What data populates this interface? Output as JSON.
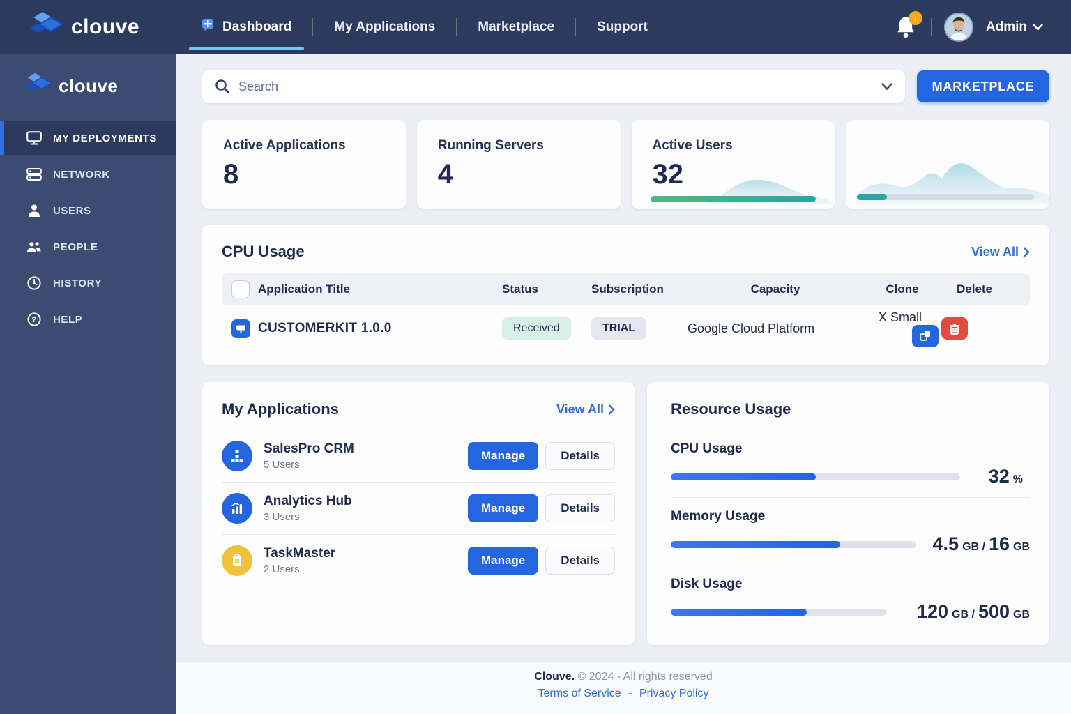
{
  "brand": {
    "name": "clouve"
  },
  "navbar": {
    "tabs": [
      {
        "label": "Dashboard"
      },
      {
        "label": "My Applications"
      },
      {
        "label": "Marketplace"
      },
      {
        "label": "Support"
      }
    ],
    "user": {
      "name": "Admin"
    }
  },
  "sidebar": {
    "items": [
      {
        "label": "MY DEPLOYMENTS"
      },
      {
        "label": "NETWORK"
      },
      {
        "label": "USERS"
      },
      {
        "label": "PEOPLE"
      },
      {
        "label": "HISTORY"
      },
      {
        "label": "HELP"
      }
    ]
  },
  "search": {
    "placeholder": "Search"
  },
  "marketplace_button": "MARKETPLACE",
  "stats": [
    {
      "label": "Active Applications",
      "value": "8"
    },
    {
      "label": "Running Servers",
      "value": "4"
    },
    {
      "label": "Active Users",
      "value": "32",
      "progress": "100%"
    },
    {
      "progress": "17%"
    }
  ],
  "cpu_table": {
    "title": "CPU Usage",
    "view_all": "View All",
    "columns": [
      "Application Title",
      "Status",
      "Subscription",
      "Capacity",
      "Clone",
      "Delete"
    ],
    "row": {
      "title": "CUSTOMERKIT 1.0.0",
      "status": "Received",
      "subscription": "TRIAL",
      "capacity": "Google Cloud Platform",
      "size": "X Small"
    }
  },
  "my_applications": {
    "title": "My Applications",
    "view_all": "View All",
    "manage_label": "Manage",
    "details_label": "Details",
    "apps": [
      {
        "name": "SalesPro CRM",
        "users": "5 Users",
        "icon": "crm-modules-icon",
        "color": "#2465e0"
      },
      {
        "name": "Analytics Hub",
        "users": "3 Users",
        "icon": "bar-chart-icon",
        "color": "#2465e0"
      },
      {
        "name": "TaskMaster",
        "users": "2 Users",
        "icon": "clipboard-icon",
        "color": "#f0c23c"
      }
    ]
  },
  "resource_usage": {
    "title": "Resource Usage",
    "meters": [
      {
        "label": "CPU Usage",
        "fill": "50%",
        "track": "415px",
        "v1": "32",
        "u1": "%",
        "v2": "",
        "u2": ""
      },
      {
        "label": "Memory Usage",
        "fill": "69%",
        "track": "352px",
        "v1": "4.5",
        "u1": "GB /",
        "v2": "16",
        "u2": "GB"
      },
      {
        "label": "Disk Usage",
        "fill": "63%",
        "track": "309px",
        "v1": "120",
        "u1": "GB /",
        "v2": "500",
        "u2": "GB"
      }
    ]
  },
  "footer": {
    "copyright_brand": "Clouve.",
    "copyright_rest": "© 2024 - All rights reserved",
    "links": [
      "Terms of Service",
      "Privacy Policy"
    ],
    "separator": "-"
  },
  "colors": {
    "accent_blue": "#2465e0",
    "navbar_bg": "#2c3a5e",
    "sidebar_bg": "#3b4b72",
    "active_underline": "#74c7f2",
    "status_received_bg": "#d7f0e5",
    "subscription_trial_bg": "#e4e6f0",
    "delete_red": "#e14b42",
    "taskmaster_yellow": "#f0c23c",
    "users_progress_teal": "#2aa6a1",
    "users_progress_green": "#52b87c"
  }
}
